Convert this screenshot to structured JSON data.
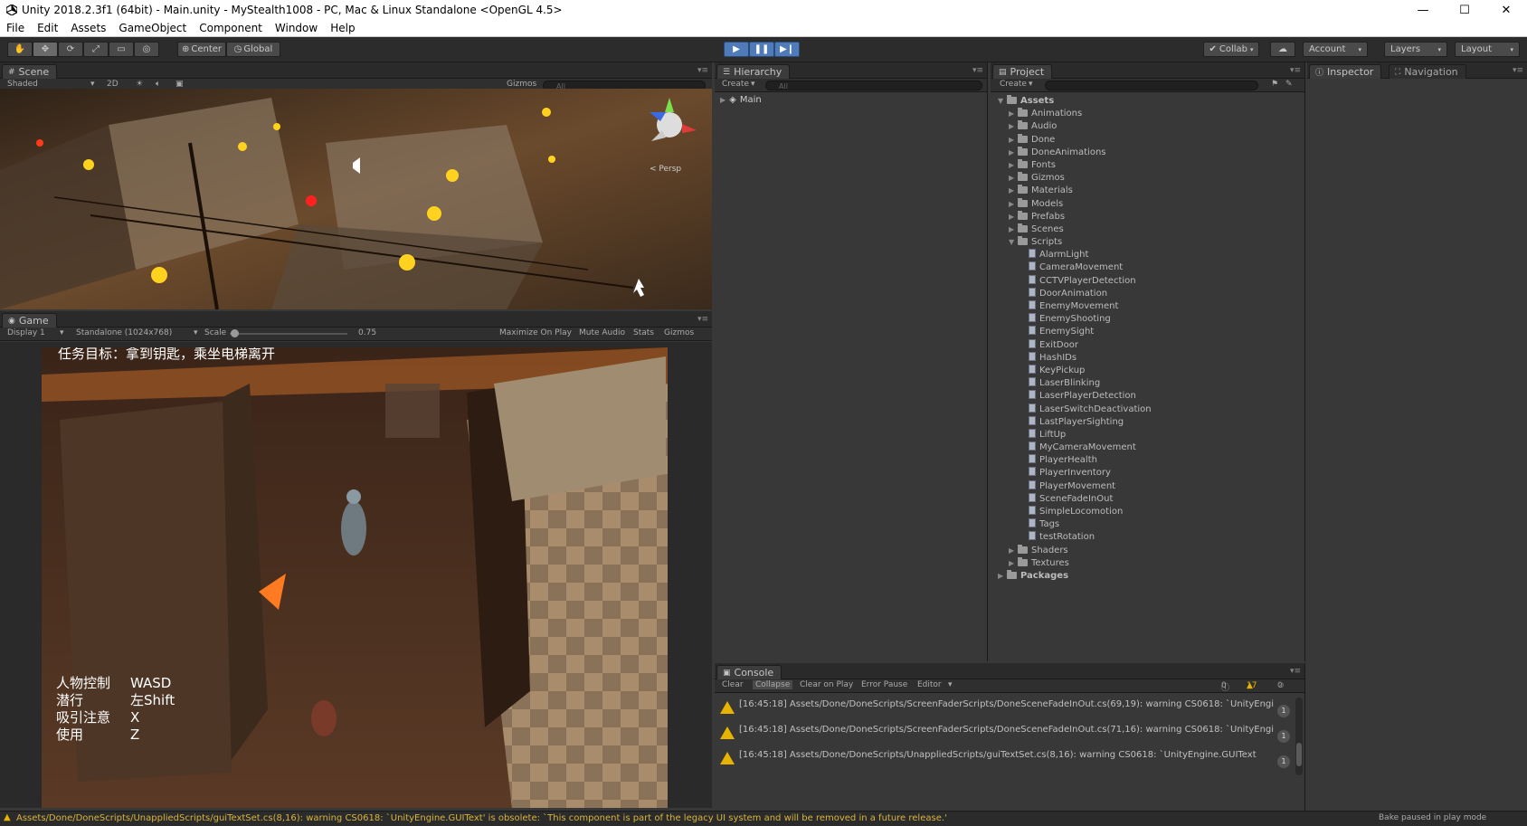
{
  "window": {
    "title": "Unity 2018.2.3f1 (64bit) - Main.unity - MyStealth1008 - PC, Mac & Linux Standalone <OpenGL 4.5>",
    "minimize": "—",
    "maximize": "☐",
    "close": "✕"
  },
  "menu": [
    "File",
    "Edit",
    "Assets",
    "GameObject",
    "Component",
    "Window",
    "Help"
  ],
  "toolbar": {
    "pivot": "Center",
    "space": "Global",
    "collab": "Collab",
    "account": "Account",
    "layers": "Layers",
    "layout": "Layout"
  },
  "scene": {
    "tab": "Scene",
    "shading": "Shaded",
    "mode2d": "2D",
    "gizmos": "Gizmos",
    "search_placeholder": "All",
    "persp": "< Persp"
  },
  "game": {
    "tab": "Game",
    "display": "Display 1",
    "resolution": "Standalone (1024x768)",
    "scale_label": "Scale",
    "scale_value": "0.75",
    "maximize": "Maximize On Play",
    "mute": "Mute Audio",
    "stats": "Stats",
    "gizmos": "Gizmos",
    "objective": "任务目标：拿到钥匙，乘坐电梯离开",
    "controls": [
      {
        "label": "人物控制",
        "key": "WASD"
      },
      {
        "label": "潜行",
        "key": "左Shift"
      },
      {
        "label": "吸引注意",
        "key": "X"
      },
      {
        "label": "使用",
        "key": "Z"
      }
    ]
  },
  "hierarchy": {
    "tab": "Hierarchy",
    "create": "Create",
    "search_placeholder": "All",
    "root": "Main"
  },
  "project": {
    "tab": "Project",
    "create": "Create",
    "assets": "Assets",
    "folders_before": [
      "Animations",
      "Audio",
      "Done",
      "DoneAnimations",
      "Fonts",
      "Gizmos",
      "Materials",
      "Models",
      "Prefabs",
      "Scenes"
    ],
    "scripts_folder": "Scripts",
    "scripts": [
      "AlarmLight",
      "CameraMovement",
      "CCTVPlayerDetection",
      "DoorAnimation",
      "EnemyMovement",
      "EnemyShooting",
      "EnemySight",
      "ExitDoor",
      "HashIDs",
      "KeyPickup",
      "LaserBlinking",
      "LaserPlayerDetection",
      "LaserSwitchDeactivation",
      "LastPlayerSighting",
      "LiftUp",
      "MyCameraMovement",
      "PlayerHealth",
      "PlayerInventory",
      "PlayerMovement",
      "SceneFadeInOut",
      "SimpleLocomotion",
      "Tags",
      "testRotation"
    ],
    "folders_after": [
      "Shaders",
      "Textures"
    ],
    "packages": "Packages"
  },
  "inspector": {
    "tab": "Inspector",
    "nav_tab": "Navigation"
  },
  "console": {
    "tab": "Console",
    "clear": "Clear",
    "collapse": "Collapse",
    "clear_on_play": "Clear on Play",
    "error_pause": "Error Pause",
    "editor": "Editor",
    "count_log": "0",
    "count_warn": "17",
    "count_err": "0",
    "entries": [
      {
        "text": "[16:45:18] Assets/Done/DoneScripts/ScreenFaderScripts/DoneSceneFadeInOut.cs(69,19): warning CS0618: `UnityEngi",
        "count": "1"
      },
      {
        "text": "[16:45:18] Assets/Done/DoneScripts/ScreenFaderScripts/DoneSceneFadeInOut.cs(71,16): warning CS0618: `UnityEngi",
        "count": "1"
      },
      {
        "text": "[16:45:18] Assets/Done/DoneScripts/UnappliedScripts/guiTextSet.cs(8,16): warning CS0618: `UnityEngine.GUIText",
        "count": "1"
      }
    ]
  },
  "status": {
    "message": "Assets/Done/DoneScripts/UnappliedScripts/guiTextSet.cs(8,16): warning CS0618: `UnityEngine.GUIText' is obsolete: `This component is part of the legacy UI system and will be removed in a future release.'",
    "bake": "Bake paused in play mode"
  },
  "colors": {
    "accent": "#4f7cb8",
    "warning": "#e6b300",
    "panel": "#383838"
  }
}
